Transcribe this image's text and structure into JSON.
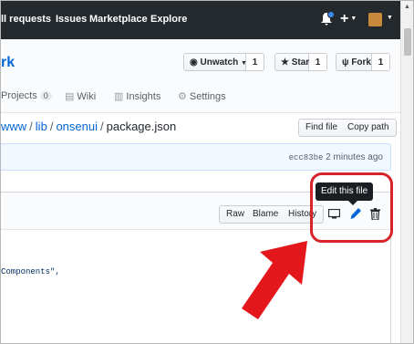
{
  "topnav": {
    "items": [
      "ll requests",
      "Issues",
      "Marketplace",
      "Explore"
    ]
  },
  "repo": {
    "name_partial": "rk",
    "unwatch": {
      "label": "Unwatch",
      "count": "1"
    },
    "star": {
      "label": "Star",
      "count": "1"
    },
    "fork": {
      "label": "Fork",
      "count": "1"
    }
  },
  "tabs": {
    "projects": {
      "label": "Projects",
      "count": "0"
    },
    "wiki": "Wiki",
    "insights": "Insights",
    "settings": "Settings"
  },
  "breadcrumb": {
    "parts": [
      "www",
      "lib",
      "onsenui"
    ],
    "file": "package.json",
    "sep": "/"
  },
  "file_actions": {
    "find_file": "Find file",
    "copy_path": "Copy path"
  },
  "commit": {
    "sha": "ecc83be",
    "time": "2 minutes ago"
  },
  "file_toolbar": {
    "raw": "Raw",
    "blame": "Blame",
    "history": "History"
  },
  "tooltip": "Edit this file",
  "code": {
    "visible_fragment": "Components\","
  },
  "colors": {
    "header_bg": "#24292e",
    "link": "#0366d6",
    "annotation": "#d8232a",
    "commit_bar_bg": "#f1f8ff"
  },
  "icons": [
    "bell-icon",
    "plus-icon",
    "avatar",
    "eye-icon",
    "star-icon",
    "fork-icon",
    "book-icon",
    "graph-icon",
    "gear-icon",
    "desktop-icon",
    "pencil-icon",
    "trash-icon",
    "red-arrow"
  ]
}
